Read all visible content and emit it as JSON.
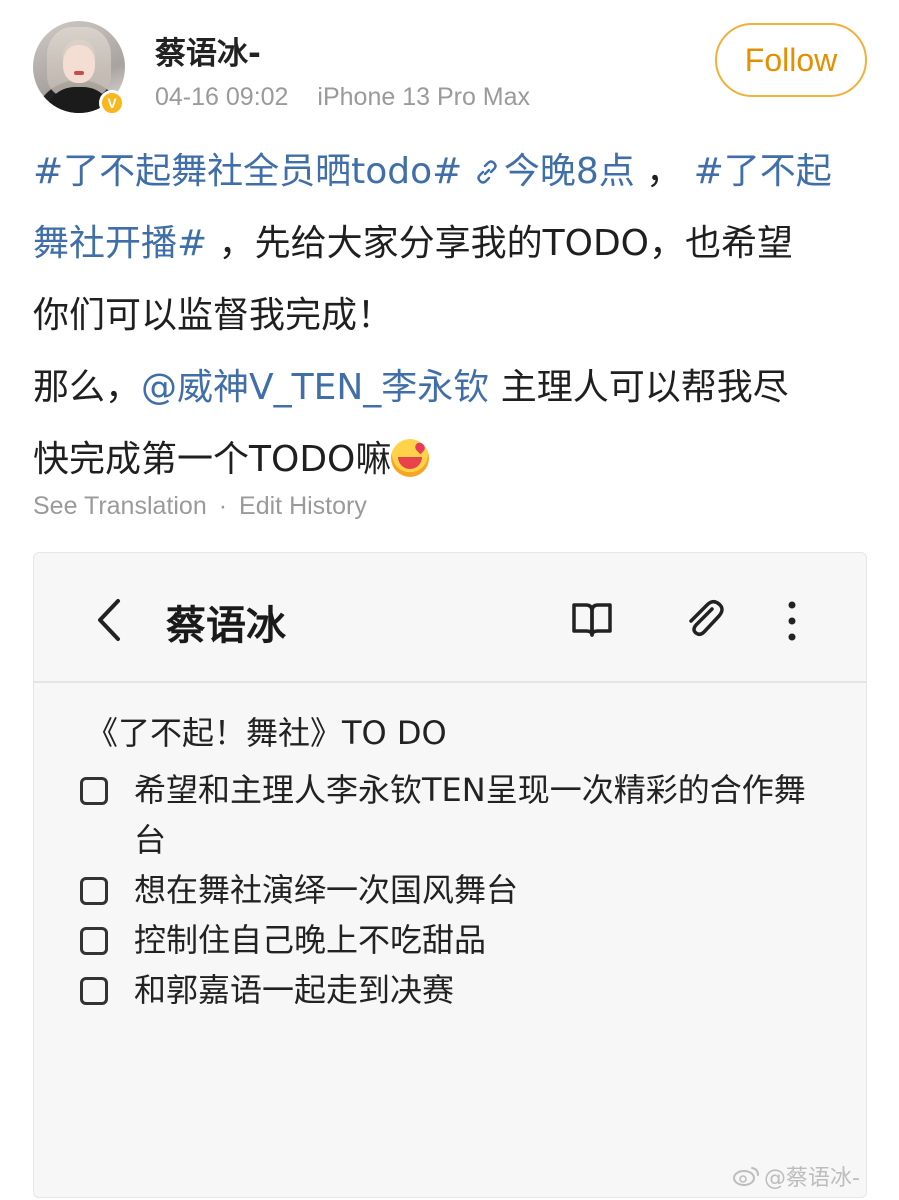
{
  "header": {
    "username": "蔡语冰-",
    "timestamp": "04-16 09:02",
    "device": "iPhone 13 Pro Max",
    "verified_badge": "V",
    "follow_label": "Follow"
  },
  "post": {
    "lines": [
      [
        {
          "text": "#了不起舞社全员晒todo#",
          "type": "hashtag"
        },
        {
          "text": " ",
          "type": "text"
        },
        {
          "text": "今晚8点",
          "type": "link"
        },
        {
          "text": " ， ",
          "type": "text"
        },
        {
          "text": "#了不起",
          "type": "hashtag"
        }
      ],
      [
        {
          "text": "舞社开播#",
          "type": "hashtag"
        },
        {
          "text": " ，先给大家分享我的TODO，也希望",
          "type": "text"
        }
      ],
      [
        {
          "text": "你们可以监督我完成！",
          "type": "text"
        }
      ],
      [
        {
          "text": "那么，",
          "type": "text"
        },
        {
          "text": "@威神V_TEN_李永钦",
          "type": "mention"
        },
        {
          "text": " 主理人可以帮我尽",
          "type": "text"
        }
      ],
      [
        {
          "text": "快完成第一个TODO嘛",
          "type": "text"
        }
      ]
    ]
  },
  "actions": {
    "see_translation": "See Translation",
    "separator": "·",
    "edit_history": "Edit History"
  },
  "note": {
    "title": "蔡语冰",
    "heading": "《了不起！舞社》TO DO",
    "items": [
      {
        "text": "希望和主理人李永钦TEN呈现一次精彩的合作舞台",
        "checked": false
      },
      {
        "text": "想在舞社演绎一次国风舞台",
        "checked": false
      },
      {
        "text": "控制住自己晚上不吃甜品",
        "checked": false
      },
      {
        "text": "和郭嘉语一起走到决赛",
        "checked": false
      }
    ]
  },
  "watermark": "@蔡语冰-",
  "colors": {
    "link": "#3f6ea8",
    "follow": "#e48f00",
    "meta": "#9a9a9a",
    "badge": "#f7b71d"
  }
}
